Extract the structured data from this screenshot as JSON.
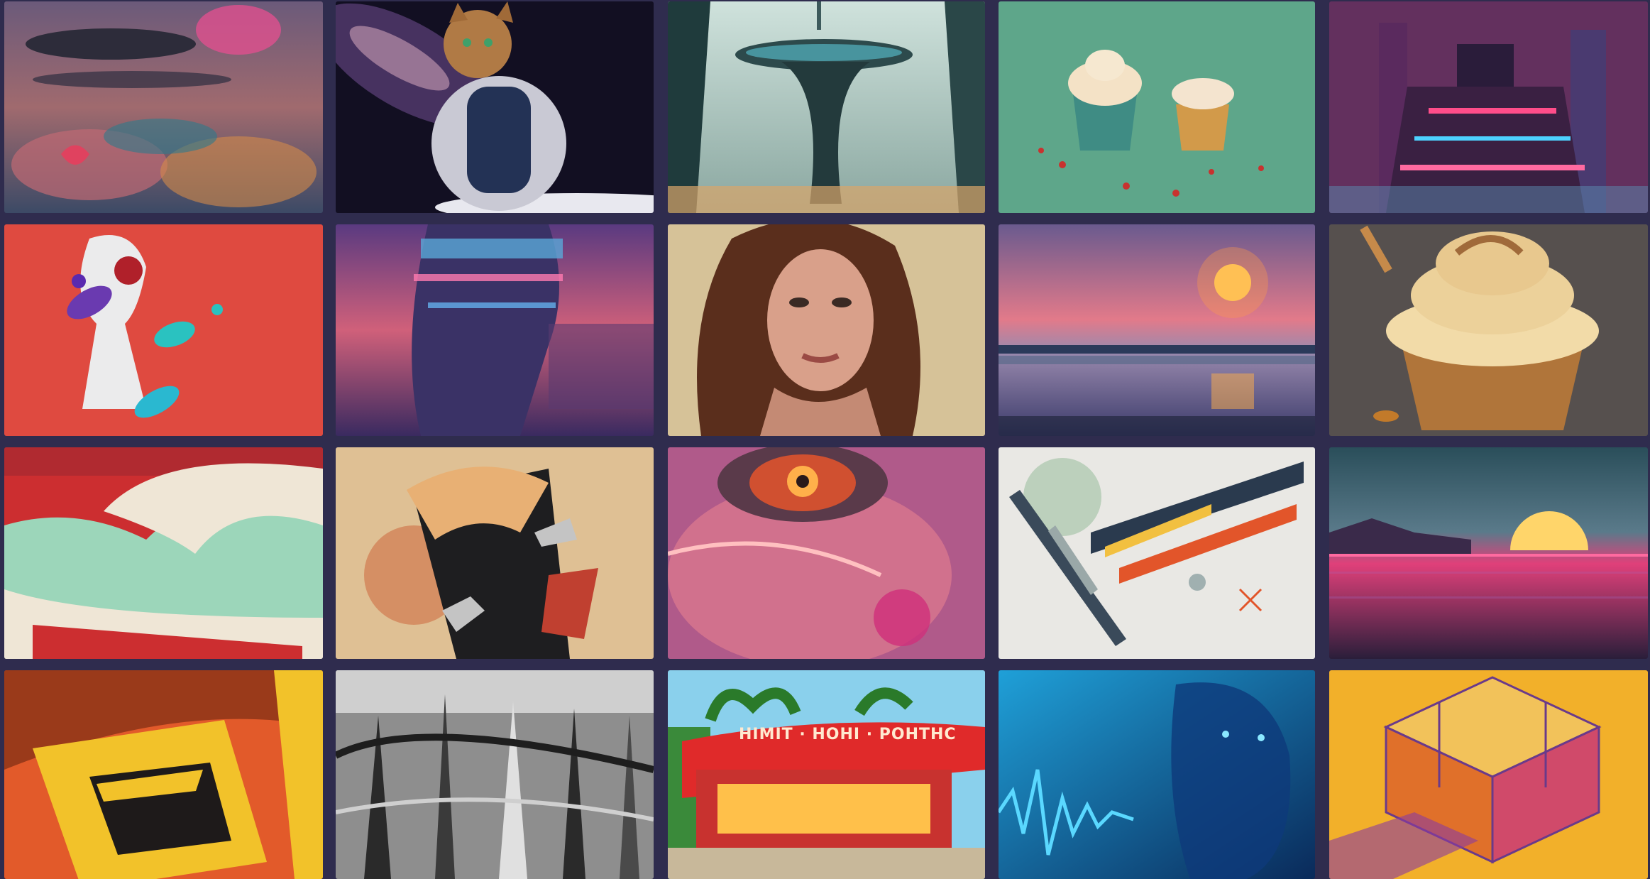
{
  "gallery": {
    "background_color": "#2f2c4e",
    "rows": 4,
    "columns": 5,
    "tiles": [
      {
        "subject": "floating ships over colorful clouds",
        "icon": "fantasy-ships-image"
      },
      {
        "subject": "cat astronaut in space",
        "icon": "cat-astronaut-image"
      },
      {
        "subject": "futuristic city tower",
        "icon": "futuristic-city-image"
      },
      {
        "subject": "two cupcakes on teal background",
        "icon": "cupcakes-image"
      },
      {
        "subject": "neon cyberpunk city",
        "icon": "neon-city-image"
      },
      {
        "subject": "statue bust collage on red",
        "icon": "statue-collage-image"
      },
      {
        "subject": "synthwave portrait with visor",
        "icon": "synthwave-portrait-image"
      },
      {
        "subject": "portrait of a woman",
        "icon": "woman-portrait-image"
      },
      {
        "subject": "sunset over water",
        "icon": "sunset-lake-image"
      },
      {
        "subject": "ice cream dessert",
        "icon": "ice-cream-image"
      },
      {
        "subject": "red great wave illustration",
        "icon": "wave-illustration-image"
      },
      {
        "subject": "open book collage",
        "icon": "book-collage-image"
      },
      {
        "subject": "fantasy eye painting",
        "icon": "eye-painting-image"
      },
      {
        "subject": "suprematist abstract shapes",
        "icon": "abstract-shapes-image"
      },
      {
        "subject": "retro sunset over sea",
        "icon": "retro-sunset-image"
      },
      {
        "subject": "yellow comic face art",
        "icon": "comic-face-image"
      },
      {
        "subject": "black and white forest",
        "icon": "forest-sketch-image"
      },
      {
        "subject": "roadside food stand",
        "icon": "food-stand-image"
      },
      {
        "subject": "digital face with sound wave",
        "icon": "digital-face-image"
      },
      {
        "subject": "isometric wireframe cube",
        "icon": "isometric-cube-image"
      }
    ],
    "food_stand_sign": "HIMIT · HOHI · POHTHC"
  }
}
